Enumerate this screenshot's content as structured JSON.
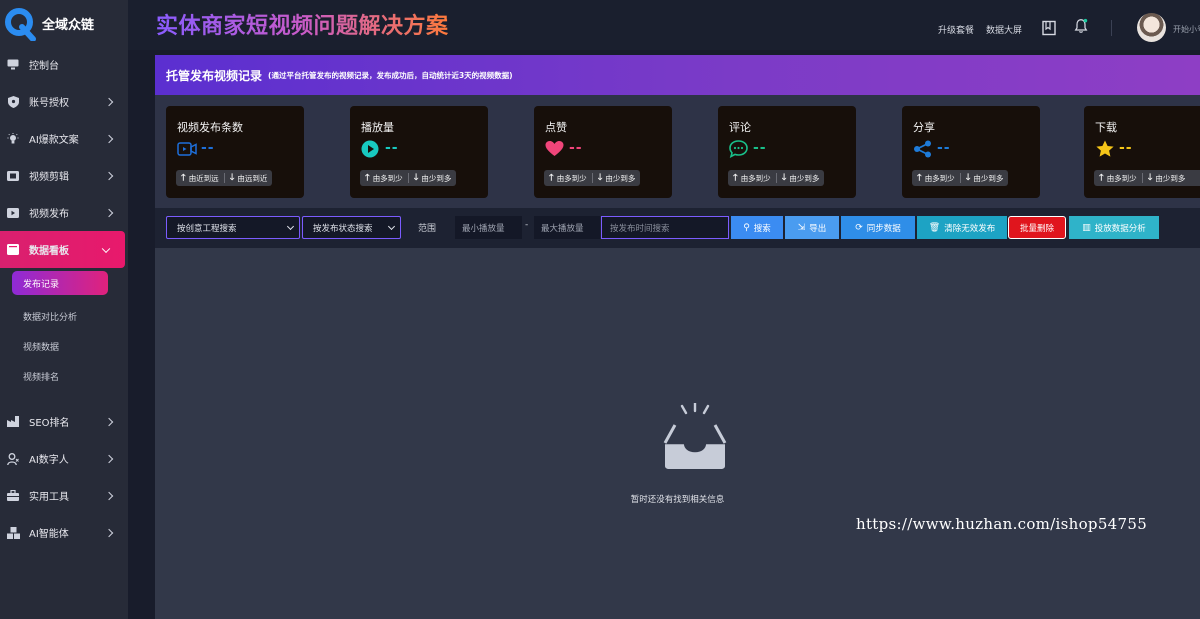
{
  "brand": {
    "name": "全域众链",
    "accent": "#e8196c"
  },
  "header": {
    "title": "实体商家短视频问题解决方案",
    "breadcrumb": "",
    "links": [
      "升级套餐",
      "数据大屏"
    ],
    "username": "开始小号"
  },
  "sidebar": {
    "items": [
      {
        "label": "控制台",
        "icon": "monitor-icon"
      },
      {
        "label": "账号授权",
        "icon": "shield-icon"
      },
      {
        "label": "AI爆款文案",
        "icon": "bulb-icon"
      },
      {
        "label": "视频剪辑",
        "icon": "film-icon"
      },
      {
        "label": "视频发布",
        "icon": "play-box-icon"
      },
      {
        "label": "数据看板",
        "icon": "board-icon"
      }
    ],
    "sub_items": [
      "发布记录",
      "数据对比分析",
      "视频数据",
      "视频排名"
    ],
    "items_after": [
      {
        "label": "SEO排名",
        "icon": "factory-icon"
      },
      {
        "label": "AI数字人",
        "icon": "person-icon"
      },
      {
        "label": "实用工具",
        "icon": "toolbox-icon"
      },
      {
        "label": "AI智能体",
        "icon": "cubes-icon"
      }
    ]
  },
  "banner": {
    "title": "托管发布视频记录",
    "note": "(通过平台托管发布的视频记录，发布成功后，自动统计近3天的视频数据)"
  },
  "stats": [
    {
      "title": "视频发布条数",
      "value": "--",
      "icon": "video-icon",
      "color": "#1e6fd9",
      "sort_up": "由近到远",
      "sort_down": "由远到近"
    },
    {
      "title": "播放量",
      "value": "--",
      "icon": "play-circle-icon",
      "color": "#18c9c0",
      "sort_up": "由多到少",
      "sort_down": "由少到多"
    },
    {
      "title": "点赞",
      "value": "--",
      "icon": "heart-icon",
      "color": "#f0457a",
      "sort_up": "由多到少",
      "sort_down": "由少到多"
    },
    {
      "title": "评论",
      "value": "--",
      "icon": "comment-icon",
      "color": "#19c08a",
      "sort_up": "由多到少",
      "sort_down": "由少到多"
    },
    {
      "title": "分享",
      "value": "--",
      "icon": "share-icon",
      "color": "#1e7bd9",
      "sort_up": "由多到少",
      "sort_down": "由少到多"
    },
    {
      "title": "下载",
      "value": "--",
      "icon": "star-icon",
      "color": "#f5c518",
      "sort_up": "由多到少",
      "sort_down": "由少到多"
    }
  ],
  "filters": {
    "project_select": "按创意工程搜索",
    "status_select": "按发布状态搜索",
    "range_label": "范围",
    "min_placeholder": "最小播放量",
    "separator": "-",
    "max_placeholder": "最大播放量",
    "date_placeholder": "按发布时间搜索"
  },
  "buttons": {
    "search": "搜索",
    "export": "导出",
    "sync": "同步数据",
    "clear_invalid": "清除无效发布",
    "batch_delete": "批量删除",
    "ad_analysis": "投放数据分析"
  },
  "empty": {
    "text": "暂时还没有找到相关信息"
  },
  "watermark": "https://www.huzhan.com/ishop54755"
}
